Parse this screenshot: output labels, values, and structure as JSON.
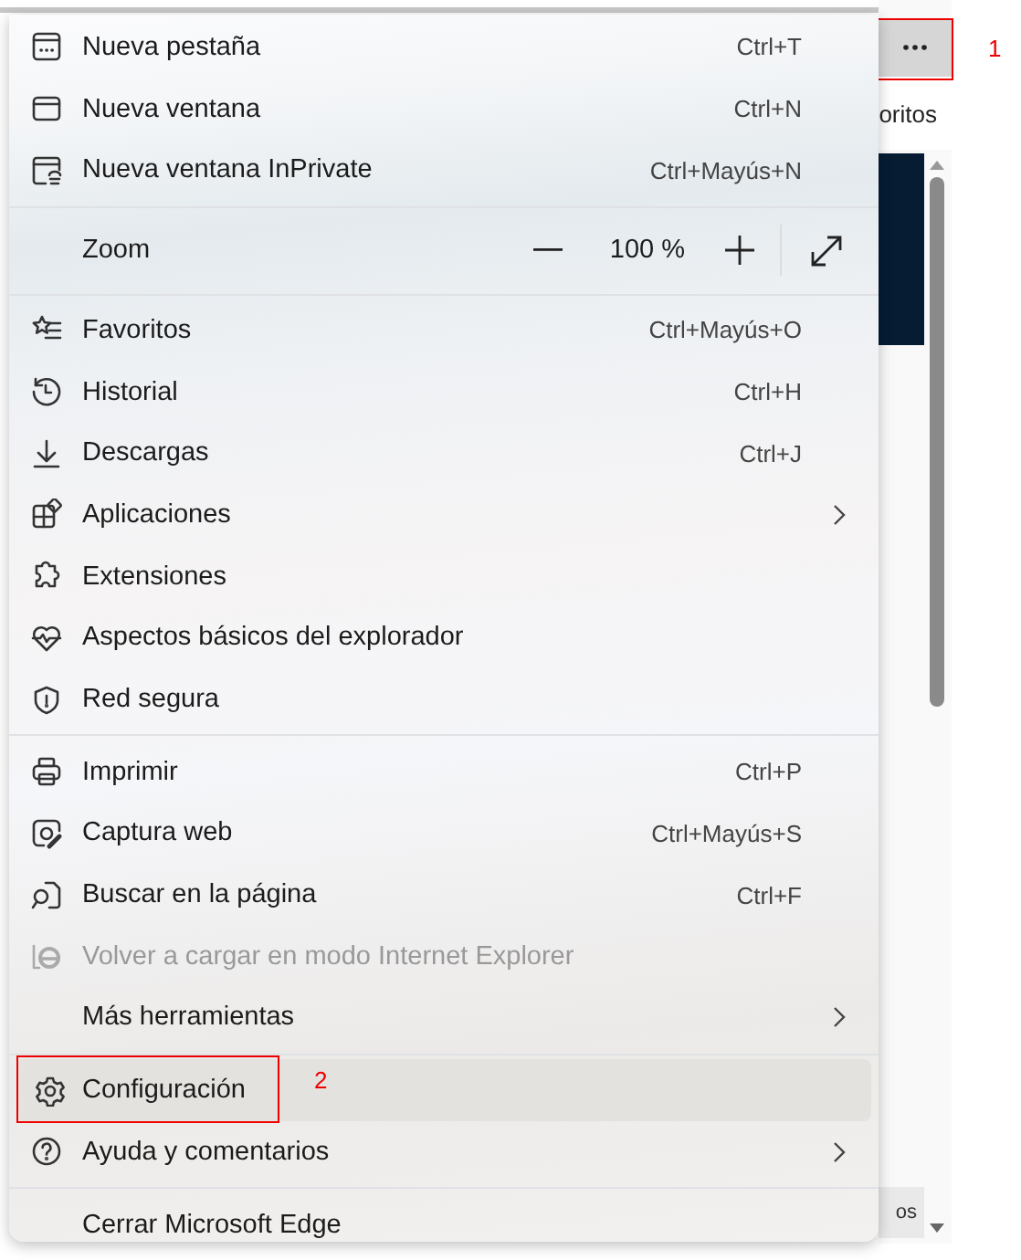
{
  "page": {
    "tab_text": "oritos",
    "bottom_button": "os"
  },
  "menu": {
    "sections": [
      {
        "items": [
          {
            "kind": "item",
            "label": "Nueva pestaña",
            "shortcut": "Ctrl+T",
            "submenu": false,
            "disabled": false,
            "selected": false
          },
          {
            "kind": "item",
            "label": "Nueva ventana",
            "shortcut": "Ctrl+N",
            "submenu": false,
            "disabled": false,
            "selected": false
          },
          {
            "kind": "item",
            "label": "Nueva ventana InPrivate",
            "shortcut": "Ctrl+Mayús+N",
            "submenu": false,
            "disabled": false,
            "selected": false
          }
        ]
      },
      {
        "items": [
          {
            "kind": "zoom",
            "label": "Zoom",
            "value": "100 %"
          }
        ]
      },
      {
        "items": [
          {
            "kind": "item",
            "label": "Favoritos",
            "shortcut": "Ctrl+Mayús+O",
            "submenu": false,
            "disabled": false,
            "selected": false
          },
          {
            "kind": "item",
            "label": "Historial",
            "shortcut": "Ctrl+H",
            "submenu": false,
            "disabled": false,
            "selected": false
          },
          {
            "kind": "item",
            "label": "Descargas",
            "shortcut": "Ctrl+J",
            "submenu": false,
            "disabled": false,
            "selected": false
          },
          {
            "kind": "item",
            "label": "Aplicaciones",
            "submenu": true,
            "disabled": false,
            "selected": false
          },
          {
            "kind": "item",
            "label": "Extensiones",
            "submenu": false,
            "disabled": false,
            "selected": false
          },
          {
            "kind": "item",
            "label": "Aspectos básicos del explorador",
            "submenu": false,
            "disabled": false,
            "selected": false
          },
          {
            "kind": "item",
            "label": "Red segura",
            "submenu": false,
            "disabled": false,
            "selected": false
          }
        ]
      },
      {
        "items": [
          {
            "kind": "item",
            "label": "Imprimir",
            "shortcut": "Ctrl+P",
            "submenu": false,
            "disabled": false,
            "selected": false
          },
          {
            "kind": "item",
            "label": "Captura web",
            "shortcut": "Ctrl+Mayús+S",
            "submenu": false,
            "disabled": false,
            "selected": false
          },
          {
            "kind": "item",
            "label": "Buscar en la página",
            "shortcut": "Ctrl+F",
            "submenu": false,
            "disabled": false,
            "selected": false
          },
          {
            "kind": "item",
            "label": "Volver a cargar en modo Internet Explorer",
            "submenu": false,
            "disabled": true,
            "selected": false
          },
          {
            "kind": "item",
            "label": "Más herramientas",
            "submenu": true,
            "disabled": false,
            "selected": false
          }
        ]
      },
      {
        "items": [
          {
            "kind": "item",
            "label": "Configuración",
            "submenu": false,
            "disabled": false,
            "selected": true
          },
          {
            "kind": "item",
            "label": "Ayuda y comentarios",
            "submenu": true,
            "disabled": false,
            "selected": false
          }
        ]
      },
      {
        "items": [
          {
            "kind": "item",
            "label": "Cerrar Microsoft Edge",
            "submenu": false,
            "disabled": false,
            "selected": false
          }
        ]
      }
    ]
  },
  "annotations": [
    {
      "label": "1"
    },
    {
      "label": "2"
    }
  ]
}
